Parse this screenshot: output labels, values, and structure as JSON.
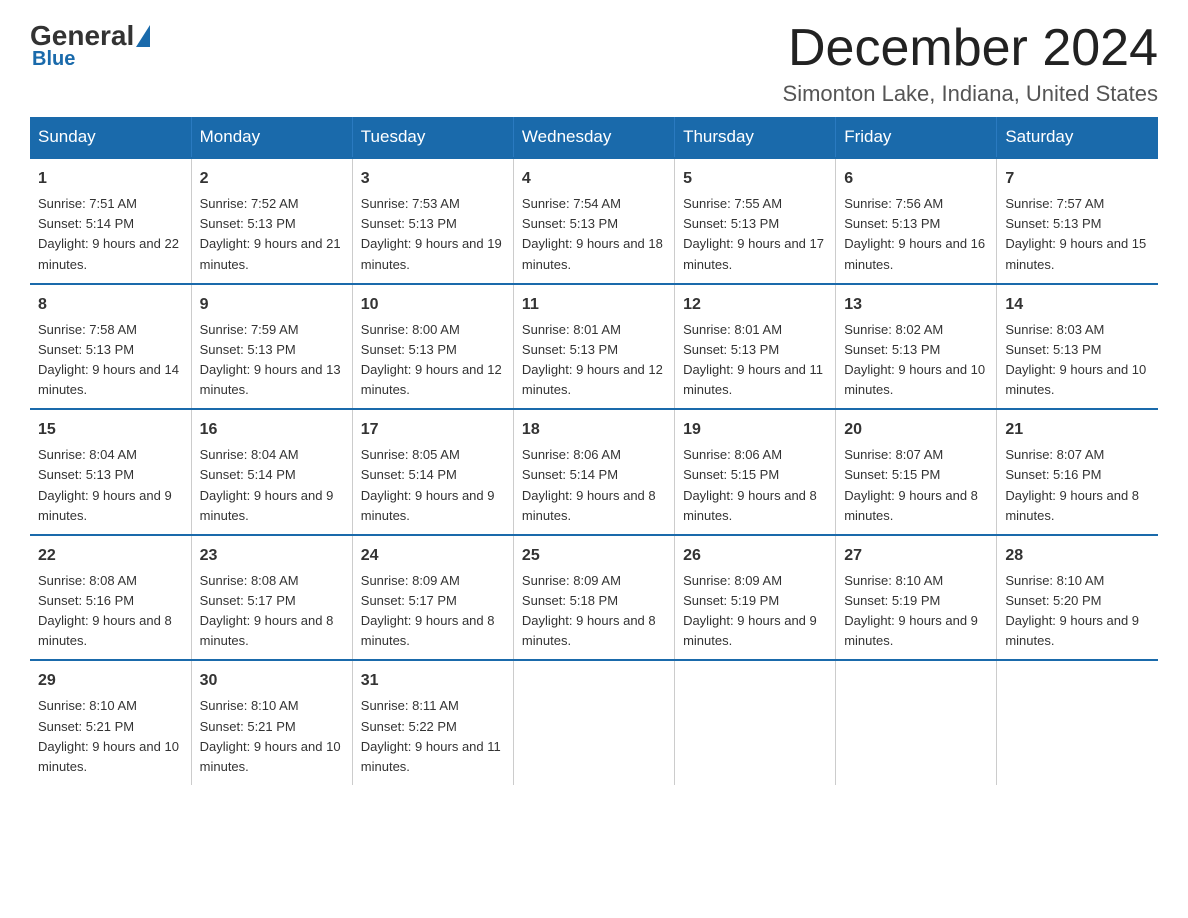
{
  "logo": {
    "general": "General",
    "blue": "Blue"
  },
  "title": "December 2024",
  "subtitle": "Simonton Lake, Indiana, United States",
  "weekdays": [
    "Sunday",
    "Monday",
    "Tuesday",
    "Wednesday",
    "Thursday",
    "Friday",
    "Saturday"
  ],
  "weeks": [
    [
      {
        "day": "1",
        "sunrise": "7:51 AM",
        "sunset": "5:14 PM",
        "daylight": "9 hours and 22 minutes."
      },
      {
        "day": "2",
        "sunrise": "7:52 AM",
        "sunset": "5:13 PM",
        "daylight": "9 hours and 21 minutes."
      },
      {
        "day": "3",
        "sunrise": "7:53 AM",
        "sunset": "5:13 PM",
        "daylight": "9 hours and 19 minutes."
      },
      {
        "day": "4",
        "sunrise": "7:54 AM",
        "sunset": "5:13 PM",
        "daylight": "9 hours and 18 minutes."
      },
      {
        "day": "5",
        "sunrise": "7:55 AM",
        "sunset": "5:13 PM",
        "daylight": "9 hours and 17 minutes."
      },
      {
        "day": "6",
        "sunrise": "7:56 AM",
        "sunset": "5:13 PM",
        "daylight": "9 hours and 16 minutes."
      },
      {
        "day": "7",
        "sunrise": "7:57 AM",
        "sunset": "5:13 PM",
        "daylight": "9 hours and 15 minutes."
      }
    ],
    [
      {
        "day": "8",
        "sunrise": "7:58 AM",
        "sunset": "5:13 PM",
        "daylight": "9 hours and 14 minutes."
      },
      {
        "day": "9",
        "sunrise": "7:59 AM",
        "sunset": "5:13 PM",
        "daylight": "9 hours and 13 minutes."
      },
      {
        "day": "10",
        "sunrise": "8:00 AM",
        "sunset": "5:13 PM",
        "daylight": "9 hours and 12 minutes."
      },
      {
        "day": "11",
        "sunrise": "8:01 AM",
        "sunset": "5:13 PM",
        "daylight": "9 hours and 12 minutes."
      },
      {
        "day": "12",
        "sunrise": "8:01 AM",
        "sunset": "5:13 PM",
        "daylight": "9 hours and 11 minutes."
      },
      {
        "day": "13",
        "sunrise": "8:02 AM",
        "sunset": "5:13 PM",
        "daylight": "9 hours and 10 minutes."
      },
      {
        "day": "14",
        "sunrise": "8:03 AM",
        "sunset": "5:13 PM",
        "daylight": "9 hours and 10 minutes."
      }
    ],
    [
      {
        "day": "15",
        "sunrise": "8:04 AM",
        "sunset": "5:13 PM",
        "daylight": "9 hours and 9 minutes."
      },
      {
        "day": "16",
        "sunrise": "8:04 AM",
        "sunset": "5:14 PM",
        "daylight": "9 hours and 9 minutes."
      },
      {
        "day": "17",
        "sunrise": "8:05 AM",
        "sunset": "5:14 PM",
        "daylight": "9 hours and 9 minutes."
      },
      {
        "day": "18",
        "sunrise": "8:06 AM",
        "sunset": "5:14 PM",
        "daylight": "9 hours and 8 minutes."
      },
      {
        "day": "19",
        "sunrise": "8:06 AM",
        "sunset": "5:15 PM",
        "daylight": "9 hours and 8 minutes."
      },
      {
        "day": "20",
        "sunrise": "8:07 AM",
        "sunset": "5:15 PM",
        "daylight": "9 hours and 8 minutes."
      },
      {
        "day": "21",
        "sunrise": "8:07 AM",
        "sunset": "5:16 PM",
        "daylight": "9 hours and 8 minutes."
      }
    ],
    [
      {
        "day": "22",
        "sunrise": "8:08 AM",
        "sunset": "5:16 PM",
        "daylight": "9 hours and 8 minutes."
      },
      {
        "day": "23",
        "sunrise": "8:08 AM",
        "sunset": "5:17 PM",
        "daylight": "9 hours and 8 minutes."
      },
      {
        "day": "24",
        "sunrise": "8:09 AM",
        "sunset": "5:17 PM",
        "daylight": "9 hours and 8 minutes."
      },
      {
        "day": "25",
        "sunrise": "8:09 AM",
        "sunset": "5:18 PM",
        "daylight": "9 hours and 8 minutes."
      },
      {
        "day": "26",
        "sunrise": "8:09 AM",
        "sunset": "5:19 PM",
        "daylight": "9 hours and 9 minutes."
      },
      {
        "day": "27",
        "sunrise": "8:10 AM",
        "sunset": "5:19 PM",
        "daylight": "9 hours and 9 minutes."
      },
      {
        "day": "28",
        "sunrise": "8:10 AM",
        "sunset": "5:20 PM",
        "daylight": "9 hours and 9 minutes."
      }
    ],
    [
      {
        "day": "29",
        "sunrise": "8:10 AM",
        "sunset": "5:21 PM",
        "daylight": "9 hours and 10 minutes."
      },
      {
        "day": "30",
        "sunrise": "8:10 AM",
        "sunset": "5:21 PM",
        "daylight": "9 hours and 10 minutes."
      },
      {
        "day": "31",
        "sunrise": "8:11 AM",
        "sunset": "5:22 PM",
        "daylight": "9 hours and 11 minutes."
      },
      null,
      null,
      null,
      null
    ]
  ]
}
